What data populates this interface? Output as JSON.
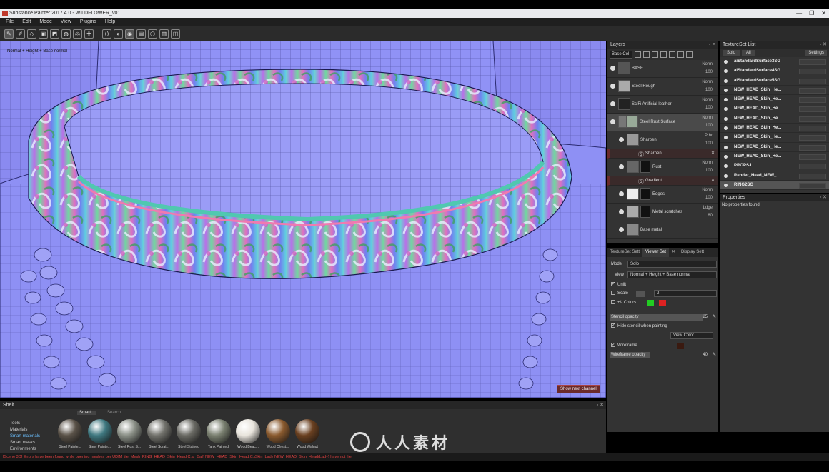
{
  "window": {
    "title": "Substance Painter 2017.4.0 - WILDFLOWER_v01",
    "controls": [
      "—",
      "❐",
      "✕"
    ]
  },
  "menu": [
    "File",
    "Edit",
    "Mode",
    "View",
    "Plugins",
    "Help"
  ],
  "viewport": {
    "channel_label": "Normal + Height + Base normal",
    "show_next_button": "Show next channel"
  },
  "layers_panel": {
    "title": "Layers",
    "blend_mode": "Base Col",
    "layers": [
      {
        "name": "BASE",
        "blend": "Norm",
        "opacity": "100",
        "type": "fill"
      },
      {
        "name": "Steel Rough",
        "blend": "Norm",
        "opacity": "100",
        "type": "fill"
      },
      {
        "name": "SciFi Artificial leather",
        "blend": "Norm",
        "opacity": "100",
        "type": "fill"
      },
      {
        "name": "Steel Rust Surface",
        "blend": "Norm",
        "opacity": "100",
        "type": "folder",
        "selected": true
      },
      {
        "name": "Sharpen",
        "blend": "Pthr",
        "opacity": "100",
        "type": "fill",
        "indent": true
      },
      {
        "name": "Sharpen",
        "type": "effect"
      },
      {
        "name": "Rust",
        "blend": "Norm",
        "opacity": "100",
        "type": "mask",
        "indent": true
      },
      {
        "name": "Gradient",
        "type": "effect"
      },
      {
        "name": "Edges",
        "blend": "Norm",
        "opacity": "100",
        "type": "mask",
        "indent": true
      },
      {
        "name": "Metal scratches",
        "blend": "Ldge",
        "opacity": "80",
        "type": "mask",
        "indent": true
      },
      {
        "name": "Base metal",
        "blend": "Norm",
        "opacity": "100",
        "type": "fill",
        "indent": true
      }
    ]
  },
  "props_tabs": [
    "TextureSet Sett",
    "Viewer Set",
    "Display Sett"
  ],
  "viewer_settings": {
    "mode_label": "Mode",
    "mode_value": "Solo",
    "view_label": "View",
    "view_value": "Normal + Height + Base normal",
    "unlit": "Unlit",
    "scale_label": "Scale",
    "scale_value": "2",
    "colors_label": "+/- Colors",
    "positive_color": "#22cc22",
    "negative_color": "#dd2222",
    "stencil_opacity_label": "Stencil opacity",
    "stencil_opacity_value": "25",
    "hide_stencil": "Hide stencil when painting",
    "view_color": "View Color",
    "wireframe": "Wireframe",
    "wireframe_color": "#3a1a10",
    "wireframe_opacity_label": "Wireframe opacity",
    "wireframe_opacity_value": "40"
  },
  "textureset_list": {
    "title": "TextureSet List",
    "tabs": [
      "Solo",
      "All"
    ],
    "settings": "Settings",
    "items": [
      "aiStandardSurface3SG",
      "aiStandardSurface4SG",
      "aiStandardSurface5SG",
      "NEW_HEAD_Skin_He...",
      "NEW_HEAD_Skin_He...",
      "NEW_HEAD_Skin_He...",
      "NEW_HEAD_Skin_He...",
      "NEW_HEAD_Skin_He...",
      "NEW_HEAD_Skin_He...",
      "NEW_HEAD_Skin_He...",
      "NEW_HEAD_Skin_He...",
      "PROPSJ",
      "Render_Head_NEW_...",
      "RING2SG"
    ]
  },
  "properties": {
    "title": "Properties",
    "empty": "No properties found"
  },
  "shelf": {
    "title": "Shelf",
    "tab": "Smart...",
    "search_placeholder": "Search...",
    "categories": [
      "Tools",
      "Materials",
      "Smart materials",
      "Smart masks",
      "Environments"
    ],
    "active_category": "Smart materials",
    "materials": [
      {
        "name": "Steel Painte...",
        "color": "#5a5248"
      },
      {
        "name": "Steel Painte...",
        "color": "#3f7880"
      },
      {
        "name": "Steel Rust S...",
        "color": "#8a8f86"
      },
      {
        "name": "Steel Scrat...",
        "color": "#72726c"
      },
      {
        "name": "Steel Stained",
        "color": "#6a6a64"
      },
      {
        "name": "Tank Painted",
        "color": "#7a8070"
      },
      {
        "name": "Wood Beac...",
        "color": "#e8e4dc"
      },
      {
        "name": "Wood Chest...",
        "color": "#8a5a2e"
      },
      {
        "name": "Wood Walnut",
        "color": "#6a4020"
      }
    ]
  },
  "log": "[Scene 3D] Errors have been found while opening meshes per UDIM tile: Mesh 'RING_HEAD_Skin_Head:C:\\c_Ball' NEW_HEAD_Skin_Head:C:\\Skin_Lady NEW_HEAD_Skin_Head(Lady) have not file",
  "watermark": "人人素材"
}
